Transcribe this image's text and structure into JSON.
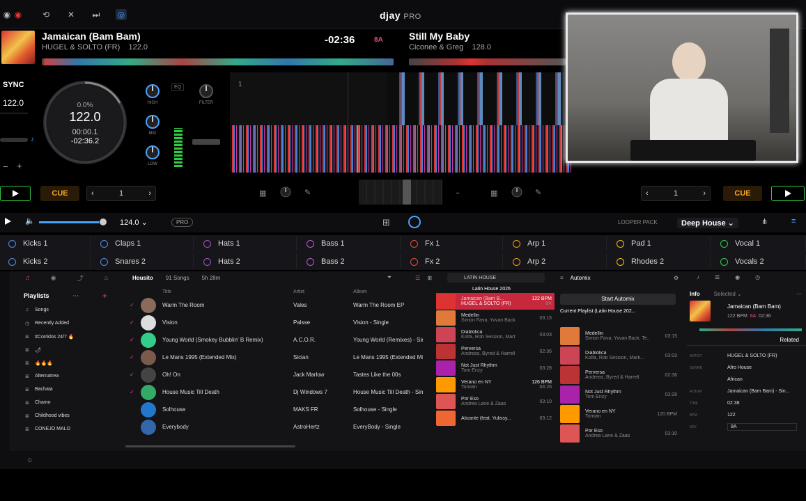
{
  "app": {
    "logo": "djay",
    "logo_suffix": "PRO"
  },
  "deckA": {
    "title": "Jamaican (Bam Bam)",
    "artist": "HUGEL & SOLTO (FR)",
    "bpm": "122.0",
    "remaining": "-02:36",
    "key": "8A",
    "sync_label": "SYNC",
    "tempo_value": "122.0",
    "platter_pitch": "0.0%",
    "platter_bpm": "122.0",
    "platter_elapsed": "00:00.1",
    "platter_remaining": "-02:36.2",
    "loop_value": "1",
    "cue_label": "CUE"
  },
  "deckB": {
    "title": "Still My Baby",
    "artist": "Ciconee & Greg",
    "bpm": "128.0",
    "loop_value": "1",
    "cue_label": "CUE"
  },
  "mixer": {
    "high": "HIGH",
    "mid": "MID",
    "low": "LOW",
    "filter": "FILTER",
    "eq": "EQ"
  },
  "looper": {
    "bpm": "124.0",
    "pro_badge": "PRO",
    "pack_label": "LOOPER PACK",
    "pack_value": "Deep House",
    "pads": [
      {
        "label": "Kicks 1",
        "color": "#4a90e2"
      },
      {
        "label": "Claps 1",
        "color": "#4a90e2"
      },
      {
        "label": "Hats 1",
        "color": "#9b59b6"
      },
      {
        "label": "Bass 1",
        "color": "#c056d6"
      },
      {
        "label": "Fx 1",
        "color": "#e74c3c"
      },
      {
        "label": "Arp 1",
        "color": "#f39c12"
      },
      {
        "label": "Pad 1",
        "color": "#f1c40f"
      },
      {
        "label": "Vocal 1",
        "color": "#2ecc40"
      },
      {
        "label": "Kicks 2",
        "color": "#4a90e2"
      },
      {
        "label": "Snares 2",
        "color": "#4a90e2"
      },
      {
        "label": "Hats 2",
        "color": "#9b59b6"
      },
      {
        "label": "Bass 2",
        "color": "#c056d6"
      },
      {
        "label": "Fx 2",
        "color": "#e74c3c"
      },
      {
        "label": "Arp 2",
        "color": "#f39c12"
      },
      {
        "label": "Rhodes 2",
        "color": "#f1c40f"
      },
      {
        "label": "Vocals 2",
        "color": "#2ecc40"
      }
    ]
  },
  "sidebar": {
    "heading": "Playlists",
    "items": [
      "Songs",
      "Recently Added",
      "#Corridos 24/7 🔥",
      "🌶",
      "🔥🔥🔥",
      "Alternatrea",
      "Bachata",
      "Chamo",
      "Childhood vibes",
      "CONEJO MALO"
    ]
  },
  "playlist": {
    "name": "Housito",
    "meta1": "91 Songs",
    "meta2": "5h 28m",
    "columns": [
      "Title",
      "Artist",
      "Album"
    ],
    "rows": [
      {
        "title": "Warm The Room",
        "artist": "Vales",
        "album": "Warm The Room EP",
        "checked": true
      },
      {
        "title": "Vision",
        "artist": "Palsse",
        "album": "Vision - Single",
        "checked": true
      },
      {
        "title": "Young World (Smokey Bubblin' B Remix)",
        "artist": "A.C.O.R.",
        "album": "Young World (Remixes) - Sin",
        "checked": true
      },
      {
        "title": "Le Mans 1995 (Extended Mix)",
        "artist": "Sician",
        "album": "Le Mans 1995 (Extended Mix",
        "checked": true
      },
      {
        "title": "Oh! On",
        "artist": "Jack Marlow",
        "album": "Tastes Like the 00s",
        "checked": true
      },
      {
        "title": "House Music Till Death",
        "artist": "Dj Windows 7",
        "album": "House Music Till Death - Sin",
        "checked": true
      },
      {
        "title": "Solhouse",
        "artist": "MAKS FR",
        "album": "Solhouse - Single",
        "checked": false
      },
      {
        "title": "Everybody",
        "artist": "AstroHertz",
        "album": "EveryBody - Single",
        "checked": false
      }
    ]
  },
  "latin": {
    "search_label": "LATIN HOUSE",
    "header": "Latin House 2026",
    "tracks": [
      {
        "title": "Jamaican (Bam B...",
        "artist": "HUGEL & SOLTO (FR)",
        "bpm": "122 BPM",
        "dur": "8A",
        "active": true
      },
      {
        "title": "Medellin",
        "artist": "Simon Fava, Yvvan Back...",
        "bpm": "",
        "dur": "03:15",
        "active": false
      },
      {
        "title": "Diablolica",
        "artist": "Kolfa, Rob Session, Mart...",
        "bpm": "",
        "dur": "03:03",
        "active": false
      },
      {
        "title": "Perversa",
        "artist": "Andreas, Byred & Harrell",
        "bpm": "",
        "dur": "02:36",
        "active": false
      },
      {
        "title": "Not Just Rhythm",
        "artist": "Tom Enzy",
        "bpm": "",
        "dur": "03:28",
        "active": false
      },
      {
        "title": "Verano en NY",
        "artist": "Tomian",
        "bpm": "126 BPM",
        "dur": "04:26",
        "active": false
      },
      {
        "title": "Por Eso",
        "artist": "Andrea Lane & Zaas",
        "bpm": "",
        "dur": "03:10",
        "active": false
      },
      {
        "title": "Alicante (feat. Yulissy...",
        "artist": "",
        "bpm": "",
        "dur": "03:12",
        "active": false
      }
    ]
  },
  "automix": {
    "title": "Automix",
    "start_label": "Start Automix",
    "current_label": "Current Playlist (Latin House 202...",
    "tracks": [
      {
        "title": "Medellin",
        "artist": "Simon Fava, Yvvan Back, Te...",
        "dur": "03:15"
      },
      {
        "title": "Diablolica",
        "artist": "Kolfa, Rob Session, Marti...",
        "dur": "03:03"
      },
      {
        "title": "Perversa",
        "artist": "Andreas, Byred & Harrell",
        "dur": "02:36"
      },
      {
        "title": "Not Just Rhythm",
        "artist": "Tom Enzy",
        "dur": "03:28"
      },
      {
        "title": "Verano en NY",
        "artist": "Tomian",
        "dur": "120 BPM"
      },
      {
        "title": "Por Eso",
        "artist": "Andrea Lane & Zaas",
        "dur": "03:10"
      }
    ]
  },
  "info": {
    "tab_info": "Info",
    "selected": "Selected",
    "title": "Jamaican (Bam Bam)",
    "bpm": "122 BPM",
    "key": "8A",
    "time": "02:36",
    "related": "Related",
    "fields": [
      {
        "label": "ARTIST",
        "value": "HUGEL & SOLTO (FR)"
      },
      {
        "label": "GENRE",
        "value": "Afro House"
      },
      {
        "label": "",
        "value": "African"
      },
      {
        "label": "ALBUM",
        "value": "Jamaican (Bam Bam) - Sin..."
      },
      {
        "label": "TIME",
        "value": "02:38"
      },
      {
        "label": "BPM",
        "value": "122"
      },
      {
        "label": "KEY",
        "value": "8A"
      }
    ]
  }
}
